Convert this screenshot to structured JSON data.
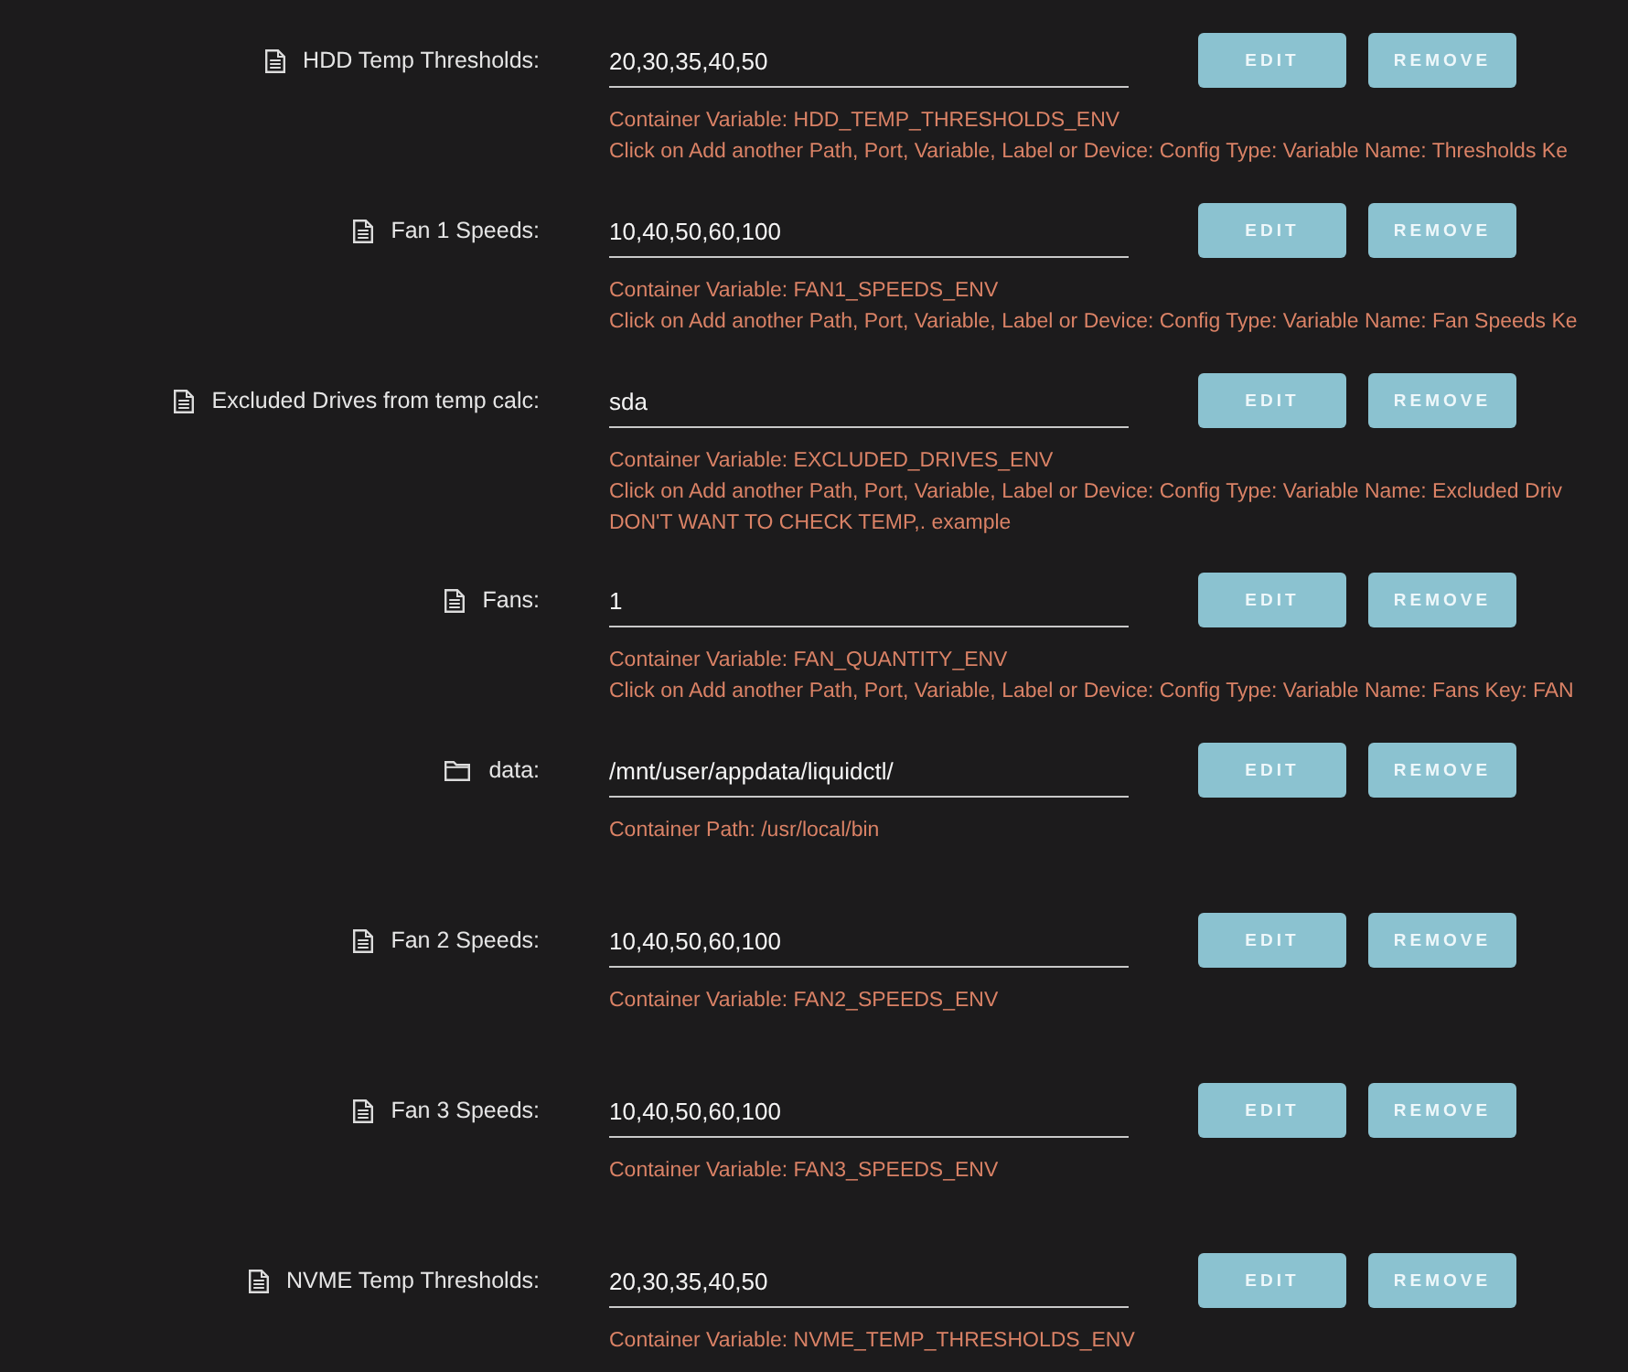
{
  "entries": [
    {
      "kind": "variable",
      "label": "HDD Temp Thresholds:",
      "value": "20,30,35,40,50",
      "buttons": [
        "EDIT",
        "REMOVE"
      ],
      "description": [
        "Container Variable: HDD_TEMP_THRESHOLDS_ENV",
        "Click on Add another Path, Port, Variable, Label or Device: Config Type: Variable Name: Thresholds Ke"
      ]
    },
    {
      "kind": "variable",
      "label": "Fan 1 Speeds:",
      "value": "10,40,50,60,100",
      "buttons": [
        "EDIT",
        "REMOVE"
      ],
      "description": [
        "Container Variable: FAN1_SPEEDS_ENV",
        "Click on Add another Path, Port, Variable, Label or Device: Config Type: Variable Name: Fan Speeds Ke"
      ]
    },
    {
      "kind": "variable",
      "label": "Excluded Drives from temp calc:",
      "value": "sda",
      "buttons": [
        "EDIT",
        "REMOVE"
      ],
      "description": [
        "Container Variable: EXCLUDED_DRIVES_ENV",
        "Click on Add another Path, Port, Variable, Label or Device: Config Type: Variable Name: Excluded Driv",
        "DON'T WANT TO CHECK TEMP,. example"
      ]
    },
    {
      "kind": "variable",
      "label": "Fans:",
      "value": "1",
      "buttons": [
        "EDIT",
        "REMOVE"
      ],
      "description": [
        "Container Variable: FAN_QUANTITY_ENV",
        "Click on Add another Path, Port, Variable, Label or Device: Config Type: Variable Name: Fans Key: FAN"
      ]
    },
    {
      "kind": "path",
      "label": "data:",
      "value": "/mnt/user/appdata/liquidctl/",
      "buttons": [
        "EDIT",
        "REMOVE"
      ],
      "description": [
        "Container Path: /usr/local/bin"
      ]
    },
    {
      "kind": "variable",
      "label": "Fan 2 Speeds:",
      "value": "10,40,50,60,100",
      "buttons": [
        "EDIT",
        "REMOVE"
      ],
      "description": [
        "Container Variable: FAN2_SPEEDS_ENV"
      ]
    },
    {
      "kind": "variable",
      "label": "Fan 3 Speeds:",
      "value": "10,40,50,60,100",
      "buttons": [
        "EDIT",
        "REMOVE"
      ],
      "description": [
        "Container Variable: FAN3_SPEEDS_ENV"
      ]
    },
    {
      "kind": "variable",
      "label": "NVME Temp Thresholds:",
      "value": "20,30,35,40,50",
      "buttons": [
        "EDIT",
        "REMOVE"
      ],
      "description": [
        "Container Variable: NVME_TEMP_THRESHOLDS_ENV"
      ]
    }
  ]
}
